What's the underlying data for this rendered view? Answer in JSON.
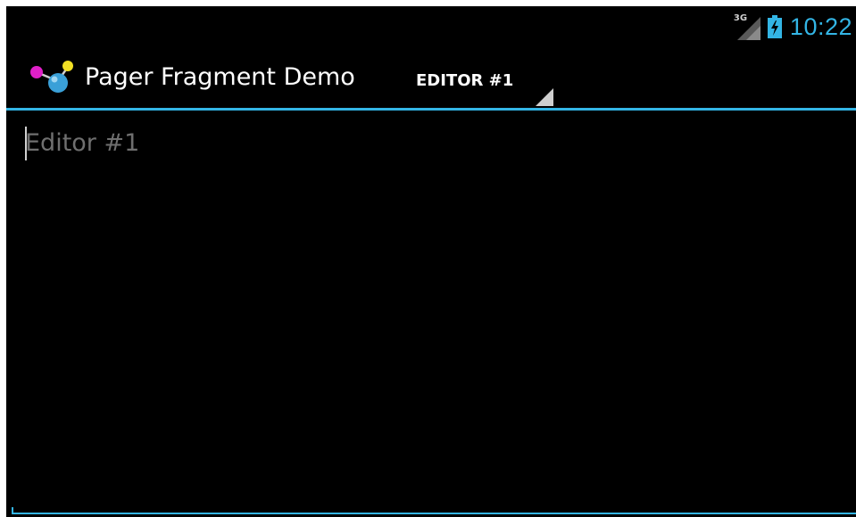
{
  "status_bar": {
    "network_type": "3G",
    "time": "10:22",
    "signal_icon": "signal-icon",
    "battery_icon": "battery-charging-icon"
  },
  "action_bar": {
    "app_icon": "molecule-app-icon",
    "title": "Pager Fragment Demo",
    "navigation": {
      "selected": "EDITOR #1",
      "dropdown_icon": "spinner-arrow-icon"
    }
  },
  "editor": {
    "placeholder": "Editor #1",
    "value": ""
  },
  "colors": {
    "accent": "#33b5e5",
    "background": "#000000",
    "text": "#ffffff",
    "hint_text": "#6f6f6f"
  }
}
